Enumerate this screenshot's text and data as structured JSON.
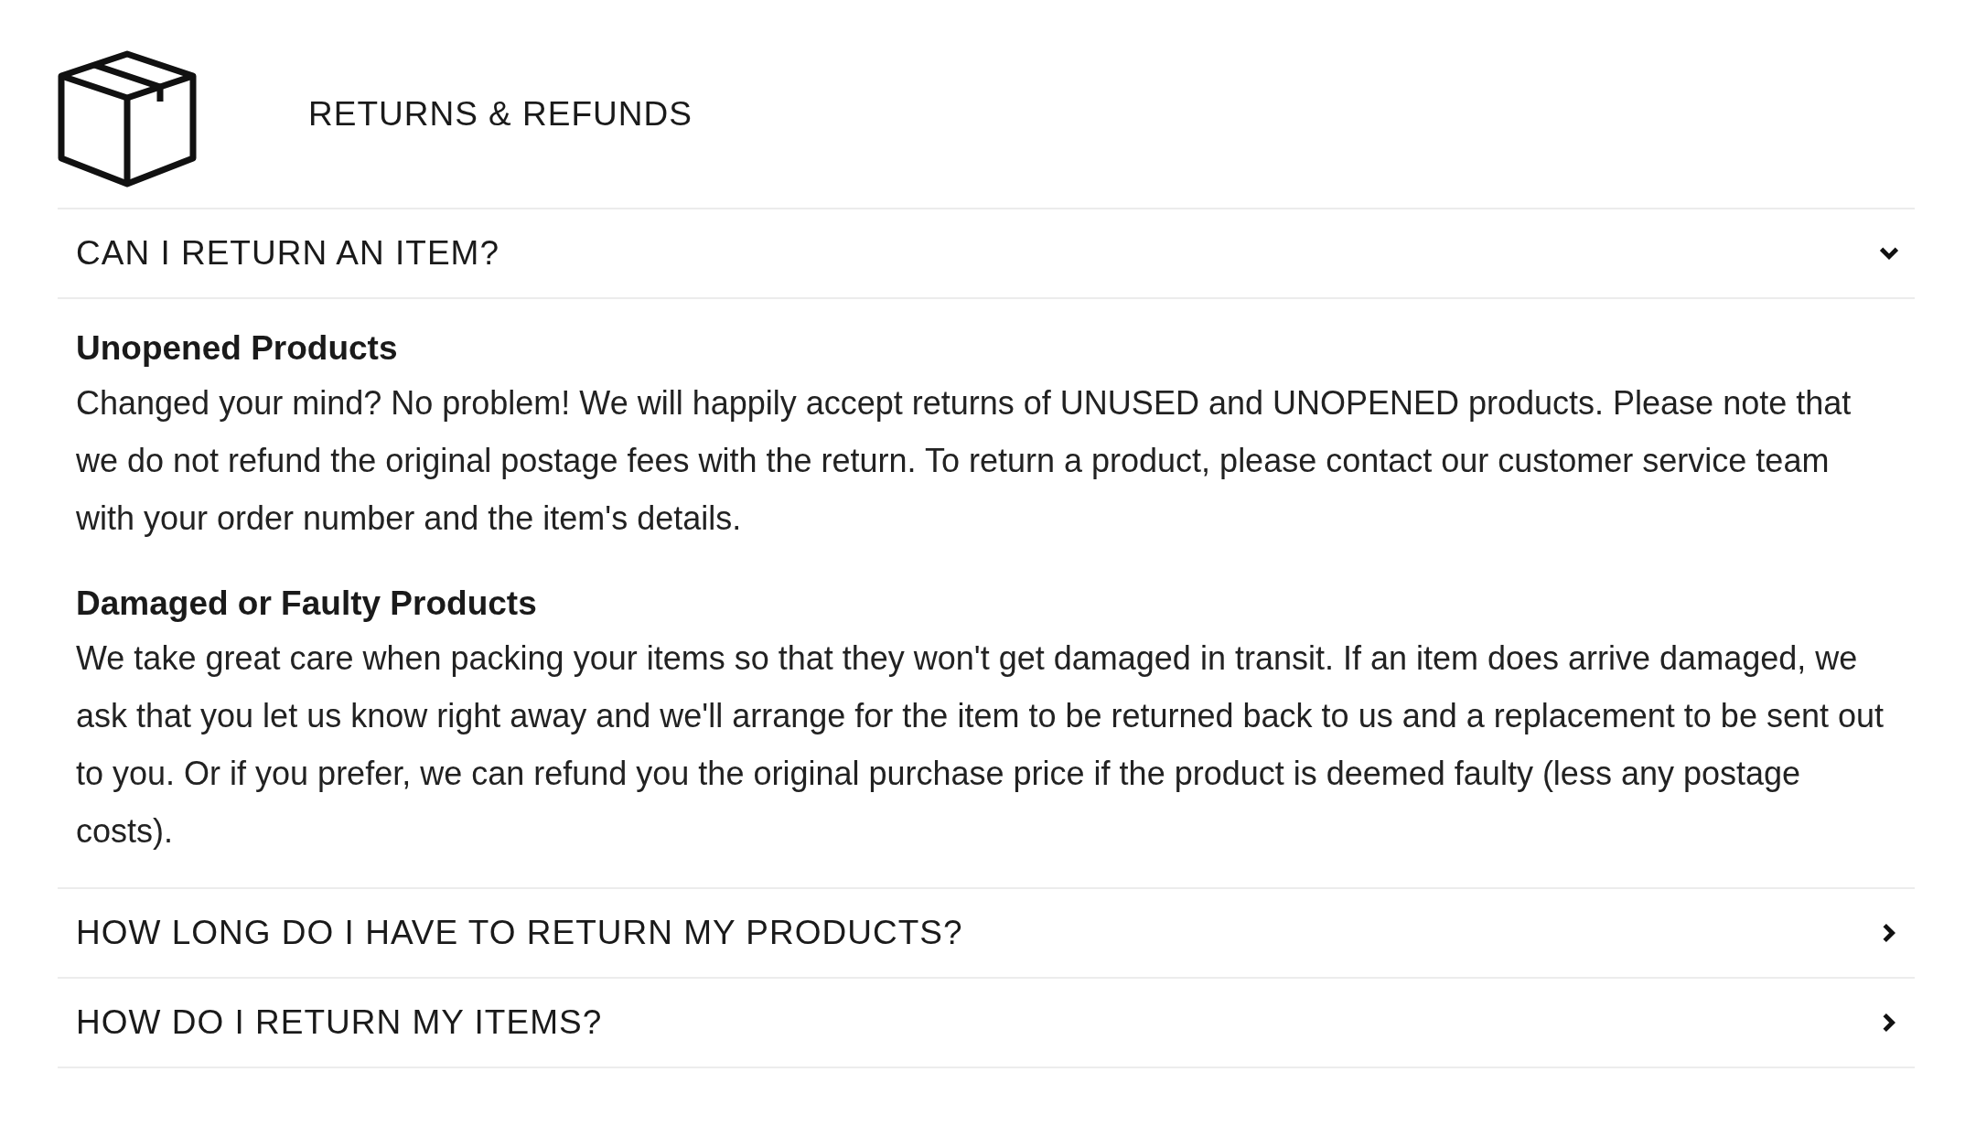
{
  "header": {
    "title": "RETURNS & REFUNDS"
  },
  "faqs": [
    {
      "question": "CAN I RETURN AN ITEM?",
      "expanded": true,
      "answer": [
        {
          "heading": "Unopened Products",
          "text": "Changed your mind? No problem! We will happily accept returns of UNUSED and UNOPENED products. Please note that we do not refund the original postage fees with the return. To return a product, please contact our customer service team with your order number and the item's details."
        },
        {
          "heading": "Damaged or Faulty Products",
          "text": "We take great care when packing your items so that they won't get damaged in transit. If an item does arrive damaged, we ask that you let us know right away and we'll arrange for the item to be returned back to us and a replacement to be sent out to you. Or if you prefer, we can refund you the original purchase price if the product is deemed faulty (less any postage costs)."
        }
      ]
    },
    {
      "question": "HOW LONG DO I HAVE TO RETURN MY PRODUCTS?",
      "expanded": false
    },
    {
      "question": "HOW DO I RETURN MY ITEMS?",
      "expanded": false
    }
  ]
}
